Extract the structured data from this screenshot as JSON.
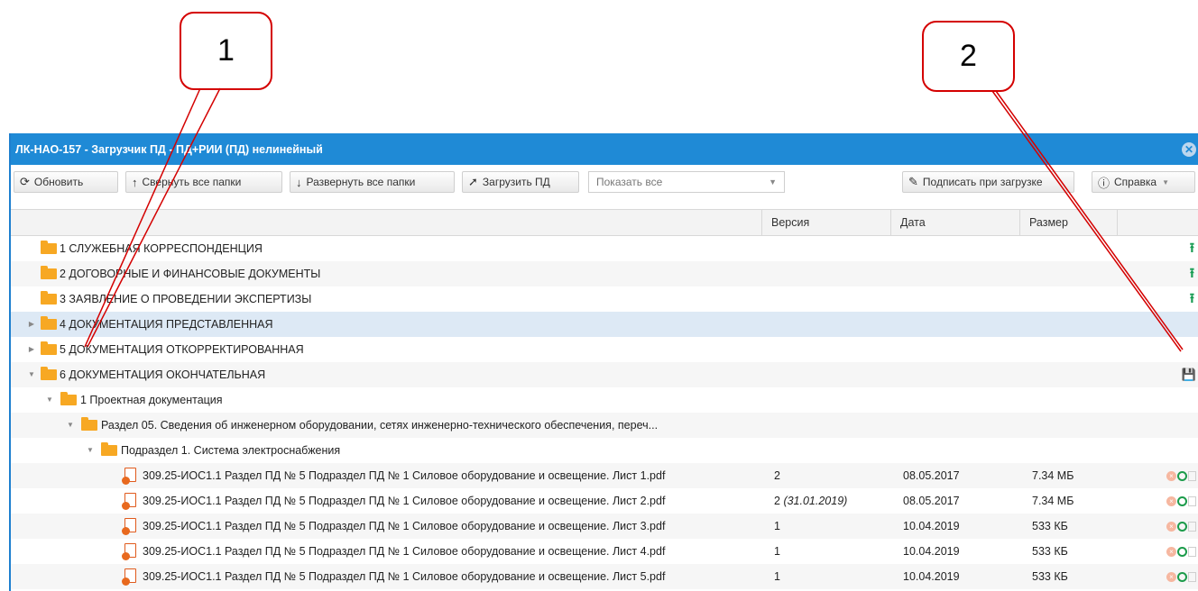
{
  "callouts": {
    "c1": "1",
    "c2": "2"
  },
  "window": {
    "title": "ЛК-НАО-157 - Загрузчик ПД - ПД+РИИ (ПД) нелинейный",
    "close_icon": "close-icon"
  },
  "toolbar": {
    "refresh": "Обновить",
    "collapse_all": "Свернуть все папки",
    "expand_all": "Развернуть все папки",
    "upload_pd": "Загрузить ПД",
    "filter_value": "Показать все",
    "sign_on_upload": "Подписать при загрузке",
    "help": "Справка"
  },
  "columns": {
    "version": "Версия",
    "date": "Дата",
    "size": "Размер"
  },
  "tree": {
    "f1": "1 СЛУЖЕБНАЯ КОРРЕСПОНДЕНЦИЯ",
    "f2": "2 ДОГОВОРНЫЕ И ФИНАНСОВЫЕ ДОКУМЕНТЫ",
    "f3": "3 ЗАЯВЛЕНИЕ О ПРОВЕДЕНИИ ЭКСПЕРТИЗЫ",
    "f4": "4 ДОКУМЕНТАЦИЯ ПРЕДСТАВЛЕННАЯ",
    "f5": "5 ДОКУМЕНТАЦИЯ ОТКОРРЕКТИРОВАННАЯ",
    "f6": "6 ДОКУМЕНТАЦИЯ ОКОНЧАТЕЛЬНАЯ",
    "f6_1": "1 Проектная документация",
    "f6_1_5": "Раздел 05. Сведения об инженерном оборудовании, сетях инженерно-технического обеспечения, переч...",
    "f6_1_5_1": "Подраздел 1. Система электроснабжения"
  },
  "files": [
    {
      "name": "309.25-ИОС1.1 Раздел ПД № 5 Подраздел ПД № 1 Силовое оборудование и освещение. Лист 1.pdf",
      "version": "2",
      "version_note": "",
      "date": "08.05.2017",
      "size": "7.34 МБ"
    },
    {
      "name": "309.25-ИОС1.1 Раздел ПД № 5 Подраздел ПД № 1 Силовое оборудование и освещение. Лист 2.pdf",
      "version": "2",
      "version_note": "(31.01.2019)",
      "date": "08.05.2017",
      "size": "7.34 МБ"
    },
    {
      "name": "309.25-ИОС1.1 Раздел ПД № 5 Подраздел ПД № 1 Силовое оборудование и освещение. Лист 3.pdf",
      "version": "1",
      "version_note": "",
      "date": "10.04.2019",
      "size": "533 КБ"
    },
    {
      "name": "309.25-ИОС1.1 Раздел ПД № 5 Подраздел ПД № 1 Силовое оборудование и освещение. Лист 4.pdf",
      "version": "1",
      "version_note": "",
      "date": "10.04.2019",
      "size": "533 КБ"
    },
    {
      "name": "309.25-ИОС1.1 Раздел ПД № 5 Подраздел ПД № 1 Силовое оборудование и освещение. Лист 5.pdf",
      "version": "1",
      "version_note": "",
      "date": "10.04.2019",
      "size": "533 КБ"
    }
  ],
  "colors": {
    "title_bar": "#1f8ad6",
    "folder": "#f7a823",
    "callout": "#d40000",
    "upload": "#1a9c54"
  }
}
